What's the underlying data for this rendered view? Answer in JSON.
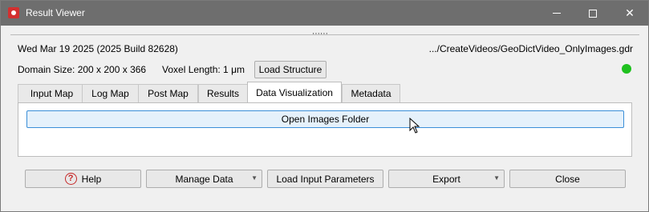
{
  "window": {
    "title": "Result Viewer"
  },
  "info": {
    "date_build": "Wed Mar 19 2025 (2025 Build 82628)",
    "file_path": ".../CreateVideos/GeoDictVideo_OnlyImages.gdr",
    "domain_size": "Domain Size: 200 x 200 x 366",
    "voxel_length": "Voxel Length: 1 μm",
    "load_structure_label": "Load Structure",
    "status_color": "#1fc11f"
  },
  "tabs": [
    {
      "label": "Input Map"
    },
    {
      "label": "Log Map"
    },
    {
      "label": "Post Map"
    },
    {
      "label": "Results"
    },
    {
      "label": "Data Visualization",
      "active": true
    },
    {
      "label": "Metadata"
    }
  ],
  "panel": {
    "open_images_label": "Open Images Folder"
  },
  "footer": {
    "help_label": "Help",
    "manage_label": "Manage Data",
    "load_input_label": "Load Input Parameters",
    "export_label": "Export",
    "close_label": "Close"
  }
}
